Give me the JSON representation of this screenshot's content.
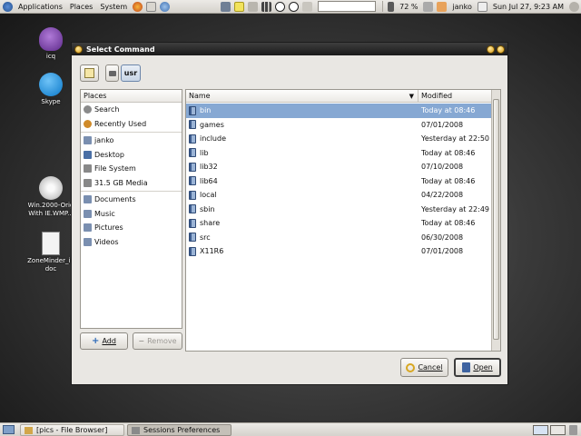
{
  "top_panel": {
    "menus": [
      "Applications",
      "Places",
      "System"
    ],
    "battery": "72 %",
    "user": "janko",
    "clock": "Sun Jul 27,  9:23 AM"
  },
  "desktop": {
    "icons": [
      {
        "label": "icq"
      },
      {
        "label": "Skype"
      },
      {
        "label": "Win.2000-Orig With IE.WMP..."
      },
      {
        "label": "ZoneMinder_in doc"
      }
    ]
  },
  "dialog": {
    "title": "Select Command",
    "path_button": "usr",
    "places_header": "Places",
    "places": [
      {
        "label": "Search",
        "icon": "search-icon",
        "color": "#8a8a8a"
      },
      {
        "label": "Recently Used",
        "icon": "clock-icon",
        "color": "#d08b2a"
      },
      {
        "label": "janko",
        "icon": "home-folder-icon",
        "color": "#7a8fb0"
      },
      {
        "label": "Desktop",
        "icon": "desktop-icon",
        "color": "#4a6fa5"
      },
      {
        "label": "File System",
        "icon": "harddisk-icon",
        "color": "#888"
      },
      {
        "label": "31.5 GB Media",
        "icon": "harddisk-icon",
        "color": "#888"
      },
      {
        "label": "Documents",
        "icon": "folder-icon",
        "color": "#7a8fb0"
      },
      {
        "label": "Music",
        "icon": "folder-icon",
        "color": "#7a8fb0"
      },
      {
        "label": "Pictures",
        "icon": "folder-icon",
        "color": "#7a8fb0"
      },
      {
        "label": "Videos",
        "icon": "folder-icon",
        "color": "#7a8fb0"
      }
    ],
    "add_label": "Add",
    "remove_label": "Remove",
    "columns": {
      "name": "Name",
      "modified": "Modified"
    },
    "files": [
      {
        "name": "bin",
        "modified": "Today at 08:46"
      },
      {
        "name": "games",
        "modified": "07/01/2008"
      },
      {
        "name": "include",
        "modified": "Yesterday at 22:50"
      },
      {
        "name": "lib",
        "modified": "Today at 08:46"
      },
      {
        "name": "lib32",
        "modified": "07/10/2008"
      },
      {
        "name": "lib64",
        "modified": "Today at 08:46"
      },
      {
        "name": "local",
        "modified": "04/22/2008"
      },
      {
        "name": "sbin",
        "modified": "Yesterday at 22:49"
      },
      {
        "name": "share",
        "modified": "Today at 08:46"
      },
      {
        "name": "src",
        "modified": "06/30/2008"
      },
      {
        "name": "X11R6",
        "modified": "07/01/2008"
      }
    ],
    "selected_file": "bin",
    "cancel_label": "Cancel",
    "open_label": "Open"
  },
  "taskbar": {
    "tasks": [
      "[pics - File Browser]",
      "Sessions Preferences"
    ]
  },
  "colors": {
    "selection": "#86a8d3",
    "titlebar": "#1a1a1a"
  }
}
